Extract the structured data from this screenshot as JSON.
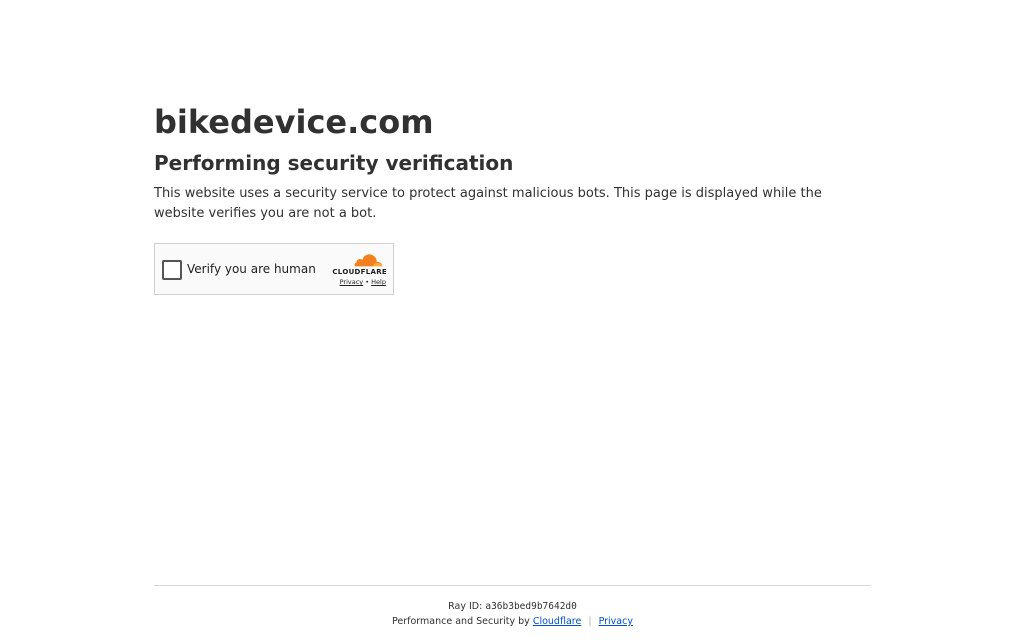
{
  "site": {
    "name": "bikedevice.com"
  },
  "content": {
    "heading": "Performing security verification",
    "description": "This website uses a security service to protect against malicious bots. This page is displayed while the website verifies you are not a bot."
  },
  "widget": {
    "checkbox_label": "Verify you are human",
    "brand": "CLOUDFLARE",
    "privacy_link": "Privacy",
    "link_separator": "•",
    "help_link": "Help",
    "brand_color": "#f38020",
    "brand_color_light": "#faae40"
  },
  "footer": {
    "ray_label": "Ray ID:",
    "ray_id": "a36b3bed9b7642d0",
    "perf_text": "Performance and Security by",
    "cloudflare_link": "Cloudflare",
    "separator": "|",
    "privacy_link": "Privacy",
    "link_color": "#0051c3"
  }
}
